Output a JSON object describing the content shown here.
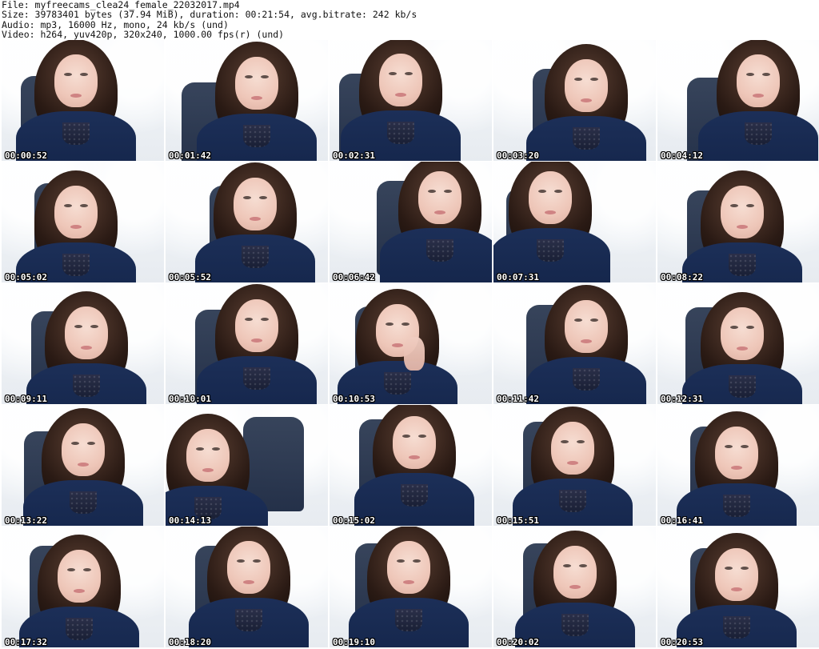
{
  "header": {
    "file_line": "File: myfreecams_clea24_female_22032017.mp4",
    "size_line": "Size: 39783401 bytes (37.94 MiB), duration: 00:21:54, avg.bitrate: 242 kb/s",
    "audio_line": "Audio: mp3, 16000 Hz, mono, 24 kb/s (und)",
    "video_line": "Video: h264, yuv420p, 320x240, 1000.00 fps(r) (und)"
  },
  "thumbnails": [
    {
      "timestamp": "00:00:52"
    },
    {
      "timestamp": "00:01:42"
    },
    {
      "timestamp": "00:02:31"
    },
    {
      "timestamp": "00:03:20"
    },
    {
      "timestamp": "00:04:12"
    },
    {
      "timestamp": "00:05:02"
    },
    {
      "timestamp": "00:05:52"
    },
    {
      "timestamp": "00:06:42"
    },
    {
      "timestamp": "00:07:31"
    },
    {
      "timestamp": "00:08:22"
    },
    {
      "timestamp": "00:09:11"
    },
    {
      "timestamp": "00:10:01"
    },
    {
      "timestamp": "00:10:53"
    },
    {
      "timestamp": "00:11:42"
    },
    {
      "timestamp": "00:12:31"
    },
    {
      "timestamp": "00:13:22"
    },
    {
      "timestamp": "00:14:13"
    },
    {
      "timestamp": "00:15:02"
    },
    {
      "timestamp": "00:15:51"
    },
    {
      "timestamp": "00:16:41"
    },
    {
      "timestamp": "00:17:32"
    },
    {
      "timestamp": "00:18:20"
    },
    {
      "timestamp": "00:19:10"
    },
    {
      "timestamp": "00:20:02"
    },
    {
      "timestamp": "00:20:53"
    }
  ],
  "colors": {
    "header_text": "#111111",
    "timestamp_text": "#ffffff",
    "timestamp_outline": "#000000",
    "top_color": "#1c2f58",
    "chair_color": "#13203a",
    "hair_color": "#2a1a14",
    "background": "#ffffff"
  }
}
